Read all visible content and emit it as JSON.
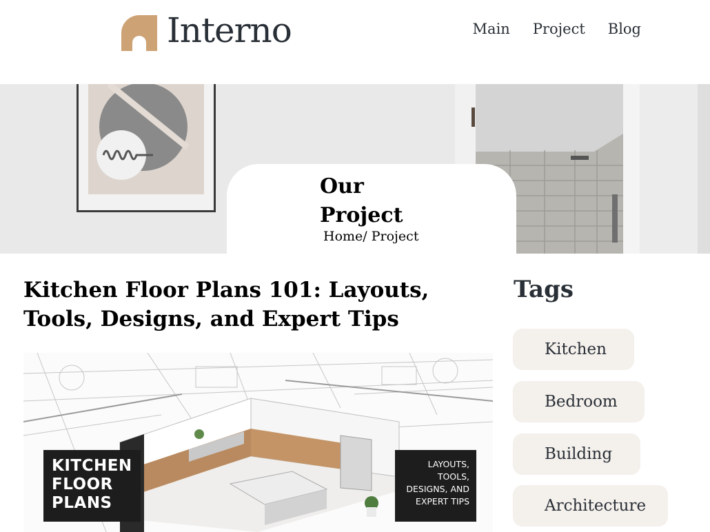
{
  "header": {
    "logo_text": "Interno",
    "nav": [
      {
        "label": "Main"
      },
      {
        "label": "Project"
      },
      {
        "label": "Blog"
      }
    ]
  },
  "hero": {
    "title_line1": "Our",
    "title_line2": "Project",
    "breadcrumb_home": "Home",
    "breadcrumb_sep": "/ ",
    "breadcrumb_current": "Project"
  },
  "article": {
    "title": "Kitchen Floor Plans 101: Layouts, Tools, Designs, and Expert Tips",
    "image_label_left": [
      "KITCHEN",
      "FLOOR",
      "PLANS"
    ],
    "image_label_right": [
      "LAYOUTS,",
      "TOOLS,",
      "DESIGNS, AND",
      "EXPERT TIPS"
    ]
  },
  "sidebar": {
    "tags_title": "Tags",
    "tags": [
      {
        "label": "Kitchen"
      },
      {
        "label": "Bedroom"
      },
      {
        "label": "Building"
      },
      {
        "label": "Architecture"
      }
    ]
  },
  "colors": {
    "logo_accent": "#cda274",
    "text_dark": "#292f36",
    "tag_bg": "#f4f0ec"
  }
}
